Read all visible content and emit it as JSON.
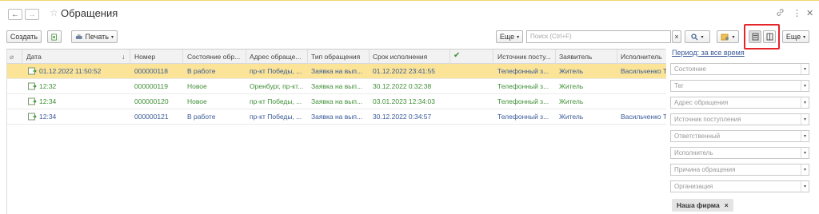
{
  "window": {
    "title": "Обращения",
    "back_icon": "←",
    "forward_icon": "→",
    "star_icon": "☆",
    "link_icon": "🔗",
    "more_icon": "⋮",
    "close_icon": "✕"
  },
  "toolbar": {
    "create_label": "Создать",
    "print_label": "Печать",
    "more_label": "Еще",
    "search_placeholder": "Поиск (Ctrl+F)",
    "more2_label": "Еще",
    "clear_label": "×"
  },
  "table": {
    "columns": [
      "Дата",
      "Номер",
      "Состояние обр...",
      "Адрес обраще...",
      "Тип обращения",
      "Срок исполнения",
      "✔",
      "Источник посту...",
      "Заявитель",
      "Исполнитель"
    ],
    "sort_indicator": "↓",
    "rows": [
      {
        "date": "01.12.2022 11:50:52",
        "number": "000000118",
        "state": "В работе",
        "address": "пр-кт Победы, ...",
        "type": "Заявка на вып...",
        "deadline": "01.12.2022 23:41:55",
        "source": "Телефонный з...",
        "applicant": "Житель",
        "executor": "Васильченко Т",
        "selected": true,
        "color": "blue"
      },
      {
        "date": "12:32",
        "number": "000000119",
        "state": "Новое",
        "address": "Оренбург, пр-кт...",
        "type": "Заявка на вып...",
        "deadline": "30.12.2022 0:32:38",
        "source": "Телефонный з...",
        "applicant": "Житель",
        "executor": "",
        "selected": false,
        "color": "green"
      },
      {
        "date": "12:34",
        "number": "000000120",
        "state": "Новое",
        "address": "пр-кт Победы, ...",
        "type": "Заявка на вып...",
        "deadline": "03.01.2023 12:34:03",
        "source": "Телефонный з...",
        "applicant": "Житель",
        "executor": "",
        "selected": false,
        "color": "green"
      },
      {
        "date": "12:34",
        "number": "000000121",
        "state": "В работе",
        "address": "пр-кт Победы, ...",
        "type": "Заявка на вып...",
        "deadline": "30.12.2022 0:34:57",
        "source": "Телефонный з...",
        "applicant": "Житель",
        "executor": "Васильченко Т",
        "selected": false,
        "color": "blue"
      }
    ]
  },
  "filters": {
    "period": "Период: за все время",
    "fields": [
      "Состояние",
      "Тег",
      "Адрес обращения",
      "Источник поступления",
      "Ответственный",
      "Исполнитель",
      "Причина обращения",
      "Организация"
    ],
    "tag": "Наша фирма",
    "tag_close": "×"
  }
}
